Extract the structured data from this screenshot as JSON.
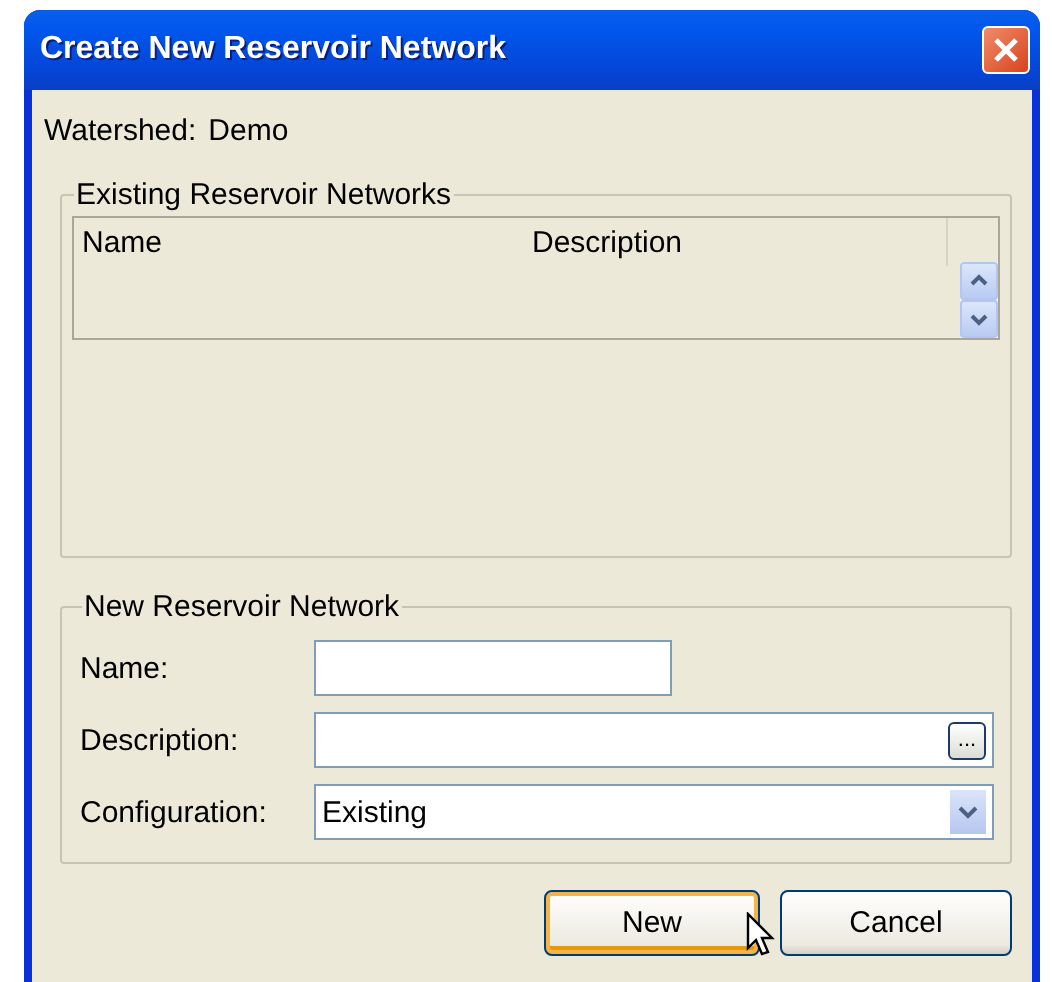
{
  "window": {
    "title": "Create New Reservoir Network"
  },
  "watershed": {
    "label": "Watershed:",
    "value": "Demo"
  },
  "existing_networks": {
    "title": "Existing Reservoir Networks",
    "columns": [
      "Name",
      "Description"
    ]
  },
  "new_network": {
    "title": "New Reservoir Network",
    "fields": [
      {
        "kind": "text",
        "label": "Name:"
      },
      {
        "kind": "text-browse",
        "label": "Description:",
        "browse": "..."
      },
      {
        "kind": "dropdown",
        "label": "Configuration:",
        "value": "Existing"
      }
    ]
  },
  "buttons": [
    {
      "label": "New",
      "default": true
    },
    {
      "label": "Cancel",
      "default": false
    }
  ]
}
